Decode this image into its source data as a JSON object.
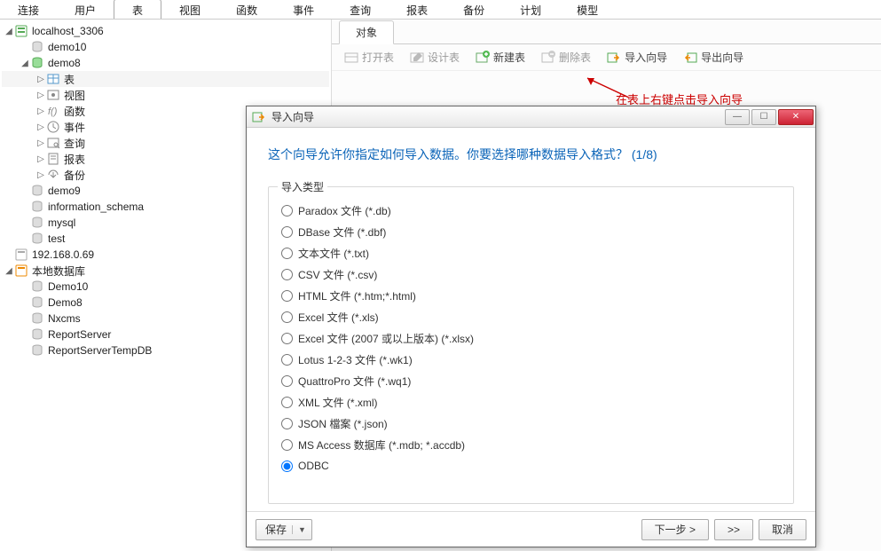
{
  "menu": {
    "items": [
      "连接",
      "用户",
      "表",
      "视图",
      "函数",
      "事件",
      "查询",
      "报表",
      "备份",
      "计划",
      "模型"
    ],
    "active_index": 2
  },
  "tree": {
    "roots": [
      {
        "name": "localhost_3306",
        "expanded": true,
        "children": [
          {
            "name": "demo10",
            "icon": "db-gray"
          },
          {
            "name": "demo8",
            "icon": "db-green",
            "expanded": true,
            "children": [
              {
                "name": "表",
                "icon": "table",
                "selected": true
              },
              {
                "name": "视图",
                "icon": "view"
              },
              {
                "name": "函数",
                "icon": "fn"
              },
              {
                "name": "事件",
                "icon": "event"
              },
              {
                "name": "查询",
                "icon": "query"
              },
              {
                "name": "报表",
                "icon": "report"
              },
              {
                "name": "备份",
                "icon": "backup"
              }
            ]
          },
          {
            "name": "demo9",
            "icon": "db-gray"
          },
          {
            "name": "information_schema",
            "icon": "db-gray"
          },
          {
            "name": "mysql",
            "icon": "db-gray"
          },
          {
            "name": "test",
            "icon": "db-gray"
          }
        ]
      },
      {
        "name": "192.168.0.69",
        "icon": "server-gray"
      },
      {
        "name": "本地数据库",
        "icon": "server-orange",
        "expanded": true,
        "children": [
          {
            "name": "Demo10",
            "icon": "db-gray"
          },
          {
            "name": "Demo8",
            "icon": "db-gray"
          },
          {
            "name": "Nxcms",
            "icon": "db-gray"
          },
          {
            "name": "ReportServer",
            "icon": "db-gray"
          },
          {
            "name": "ReportServerTempDB",
            "icon": "db-gray"
          }
        ]
      }
    ]
  },
  "content": {
    "tab": "对象",
    "toolbar": {
      "open": "打开表",
      "design": "设计表",
      "new": "新建表",
      "delete": "删除表",
      "import": "导入向导",
      "export": "导出向导"
    },
    "annotation": "在表上右键点击导入向导\n或者点击此处。"
  },
  "dialog": {
    "title": "导入向导",
    "heading": "这个向导允许你指定如何导入数据。你要选择哪种数据导入格式？ (1/8)",
    "group_title": "导入类型",
    "options": [
      "Paradox 文件 (*.db)",
      "DBase 文件 (*.dbf)",
      "文本文件 (*.txt)",
      "CSV 文件 (*.csv)",
      "HTML 文件 (*.htm;*.html)",
      "Excel 文件 (*.xls)",
      "Excel 文件 (2007 或以上版本) (*.xlsx)",
      "Lotus 1-2-3 文件 (*.wk1)",
      "QuattroPro 文件 (*.wq1)",
      "XML 文件 (*.xml)",
      "JSON 檔案 (*.json)",
      "MS Access 数据库 (*.mdb; *.accdb)",
      "ODBC"
    ],
    "selected_index": 12,
    "buttons": {
      "save": "保存",
      "next": "下一步 >",
      "fwd": ">>",
      "cancel": "取消"
    }
  }
}
